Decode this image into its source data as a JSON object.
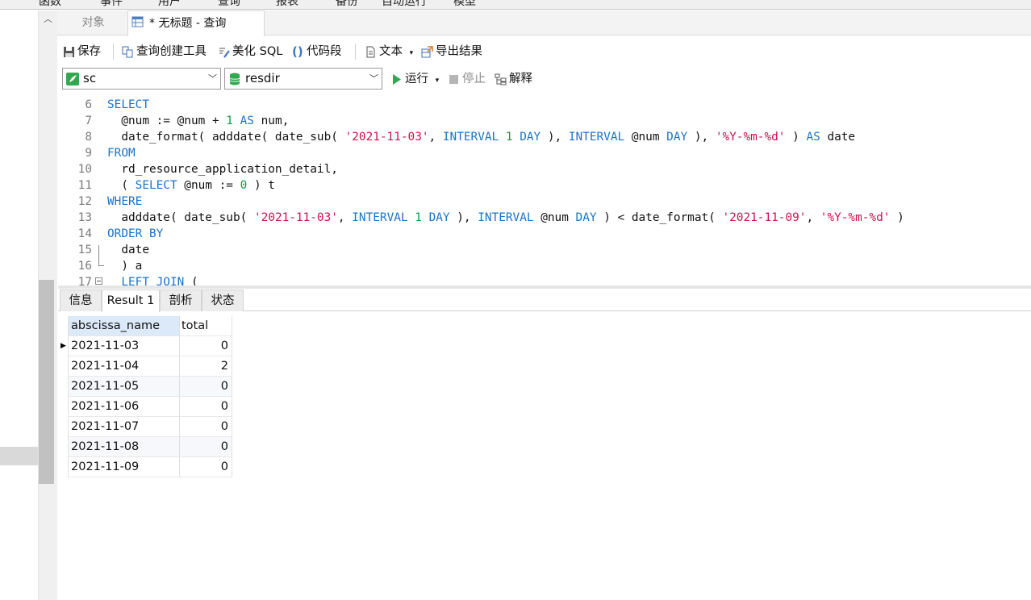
{
  "menubar": {
    "items": [
      "函数",
      "事件",
      "用户",
      "查询",
      "报表",
      "备份",
      "自动运行",
      "模型"
    ]
  },
  "tabs": {
    "objects": "对象",
    "query": "* 无标题 - 查询"
  },
  "toolbar1": {
    "save": "保存",
    "query_builder": "查询创建工具",
    "beautify": "美化 SQL",
    "snippet": "代码段",
    "text": "文本",
    "export": "导出结果"
  },
  "toolbar2": {
    "connection": "sc",
    "database": "resdir",
    "run": "运行",
    "stop": "停止",
    "explain": "解释"
  },
  "editor": {
    "lines": [
      {
        "n": "6",
        "parts": [
          [
            "kw",
            "SELECT"
          ]
        ]
      },
      {
        "n": "7",
        "parts": [
          [
            "t",
            "  @num := @num + "
          ],
          [
            "num",
            "1"
          ],
          [
            "t",
            " "
          ],
          [
            "kw",
            "AS"
          ],
          [
            "t",
            " num,"
          ]
        ]
      },
      {
        "n": "8",
        "parts": [
          [
            "t",
            "  date_format( adddate( date_sub( "
          ],
          [
            "str",
            "'2021-11-03'"
          ],
          [
            "t",
            ", "
          ],
          [
            "kw",
            "INTERVAL"
          ],
          [
            "t",
            " "
          ],
          [
            "num",
            "1"
          ],
          [
            "t",
            " "
          ],
          [
            "kw",
            "DAY"
          ],
          [
            "t",
            " ), "
          ],
          [
            "kw",
            "INTERVAL"
          ],
          [
            "t",
            " @num "
          ],
          [
            "kw",
            "DAY"
          ],
          [
            "t",
            " ), "
          ],
          [
            "str",
            "'%Y-%m-%d'"
          ],
          [
            "t",
            " ) "
          ],
          [
            "kw",
            "AS"
          ],
          [
            "t",
            " date"
          ]
        ]
      },
      {
        "n": "9",
        "parts": [
          [
            "kw",
            "FROM"
          ]
        ]
      },
      {
        "n": "10",
        "parts": [
          [
            "t",
            "  rd_resource_application_detail,"
          ]
        ]
      },
      {
        "n": "11",
        "parts": [
          [
            "t",
            "  ( "
          ],
          [
            "kw",
            "SELECT"
          ],
          [
            "t",
            " @num := "
          ],
          [
            "num",
            "0"
          ],
          [
            "t",
            " ) t"
          ]
        ]
      },
      {
        "n": "12",
        "parts": [
          [
            "kw",
            "WHERE"
          ]
        ]
      },
      {
        "n": "13",
        "parts": [
          [
            "t",
            "  adddate( date_sub( "
          ],
          [
            "str",
            "'2021-11-03'"
          ],
          [
            "t",
            ", "
          ],
          [
            "kw",
            "INTERVAL"
          ],
          [
            "t",
            " "
          ],
          [
            "num",
            "1"
          ],
          [
            "t",
            " "
          ],
          [
            "kw",
            "DAY"
          ],
          [
            "t",
            " ), "
          ],
          [
            "kw",
            "INTERVAL"
          ],
          [
            "t",
            " @num "
          ],
          [
            "kw",
            "DAY"
          ],
          [
            "t",
            " ) < date_format( "
          ],
          [
            "str",
            "'2021-11-09'"
          ],
          [
            "t",
            ", "
          ],
          [
            "str",
            "'%Y-%m-%d'"
          ],
          [
            "t",
            " )"
          ]
        ]
      },
      {
        "n": "14",
        "parts": [
          [
            "kw",
            "ORDER BY"
          ]
        ]
      },
      {
        "n": "15",
        "parts": [
          [
            "t",
            "  date"
          ]
        ]
      },
      {
        "n": "16",
        "parts": [
          [
            "t",
            "  ) a"
          ]
        ]
      },
      {
        "n": "17",
        "parts": [
          [
            "t",
            "  "
          ],
          [
            "kw",
            "LEFT JOIN"
          ],
          [
            "t",
            " ("
          ]
        ]
      }
    ]
  },
  "result_tabs": [
    "信息",
    "Result 1",
    "剖析",
    "状态"
  ],
  "grid": {
    "columns": [
      "abscissa_name",
      "total"
    ],
    "rows": [
      [
        "2021-11-03",
        "0"
      ],
      [
        "2021-11-04",
        "2"
      ],
      [
        "2021-11-05",
        "0"
      ],
      [
        "2021-11-06",
        "0"
      ],
      [
        "2021-11-07",
        "0"
      ],
      [
        "2021-11-08",
        "0"
      ],
      [
        "2021-11-09",
        "0"
      ]
    ]
  },
  "colors": {
    "keyword": "#1a73c9",
    "string": "#d0114c",
    "number": "#0d9e44",
    "run_icon": "#2fa84f",
    "header_bg": "#dbe9f8"
  }
}
